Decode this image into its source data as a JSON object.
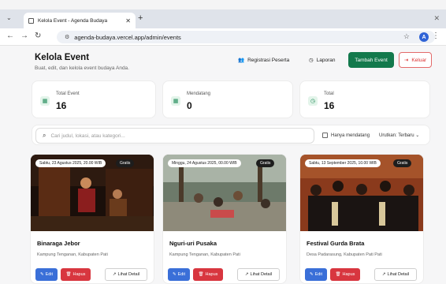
{
  "browser": {
    "tab_title": "Kelola Event - Agenda Budaya",
    "tab_close": "✕",
    "new_tab": "+",
    "url": "agenda-budaya.vercel.app/admin/events",
    "profile_initial": "A"
  },
  "header": {
    "title": "Kelola Event",
    "subtitle": "Buat, edit, dan kelola event budaya Anda.",
    "registrasi_label": "Registrasi Peserta",
    "laporan_label": "Laporan",
    "tambah_label": "Tambah Event",
    "keluar_label": "Keluar"
  },
  "stats": [
    {
      "label": "Total Event",
      "value": "16",
      "icon": "calendar-icon"
    },
    {
      "label": "Mendatang",
      "value": "0",
      "icon": "calendar-icon"
    },
    {
      "label": "Total",
      "value": "16",
      "icon": "clock-icon"
    }
  ],
  "filter": {
    "search_placeholder": "Cari judul, lokasi, atau kategori...",
    "checkbox_label": "Hanya mendatang",
    "sort_label": "Urutkan: Terbaru"
  },
  "events": [
    {
      "date": "Sabtu, 23 Agustus 2025, 20.00 WIB",
      "badge": "Gratis",
      "title": "Binaraga Jebor",
      "location": "Kampung Tenganan, Kabupaten Pati"
    },
    {
      "date": "Minggu, 24 Agustus 2025, 00.00 WIB",
      "badge": "Gratis",
      "title": "Nguri-uri Pusaka",
      "location": "Kampung Tenganan, Kabupaten Pati"
    },
    {
      "date": "Sabtu, 13 September 2025, 10.00 WIB",
      "badge": "Gratis",
      "title": "Festival Gurda Brata",
      "location": "Desa Padarasung, Kabupaten Pati Pati"
    }
  ],
  "card_buttons": {
    "edit": "Edit",
    "hapus": "Hapus",
    "detail": "Lihat Detail"
  },
  "colors": {
    "primary_green": "#13794c",
    "edit_blue": "#3a6fd8",
    "delete_red": "#d8363f"
  }
}
